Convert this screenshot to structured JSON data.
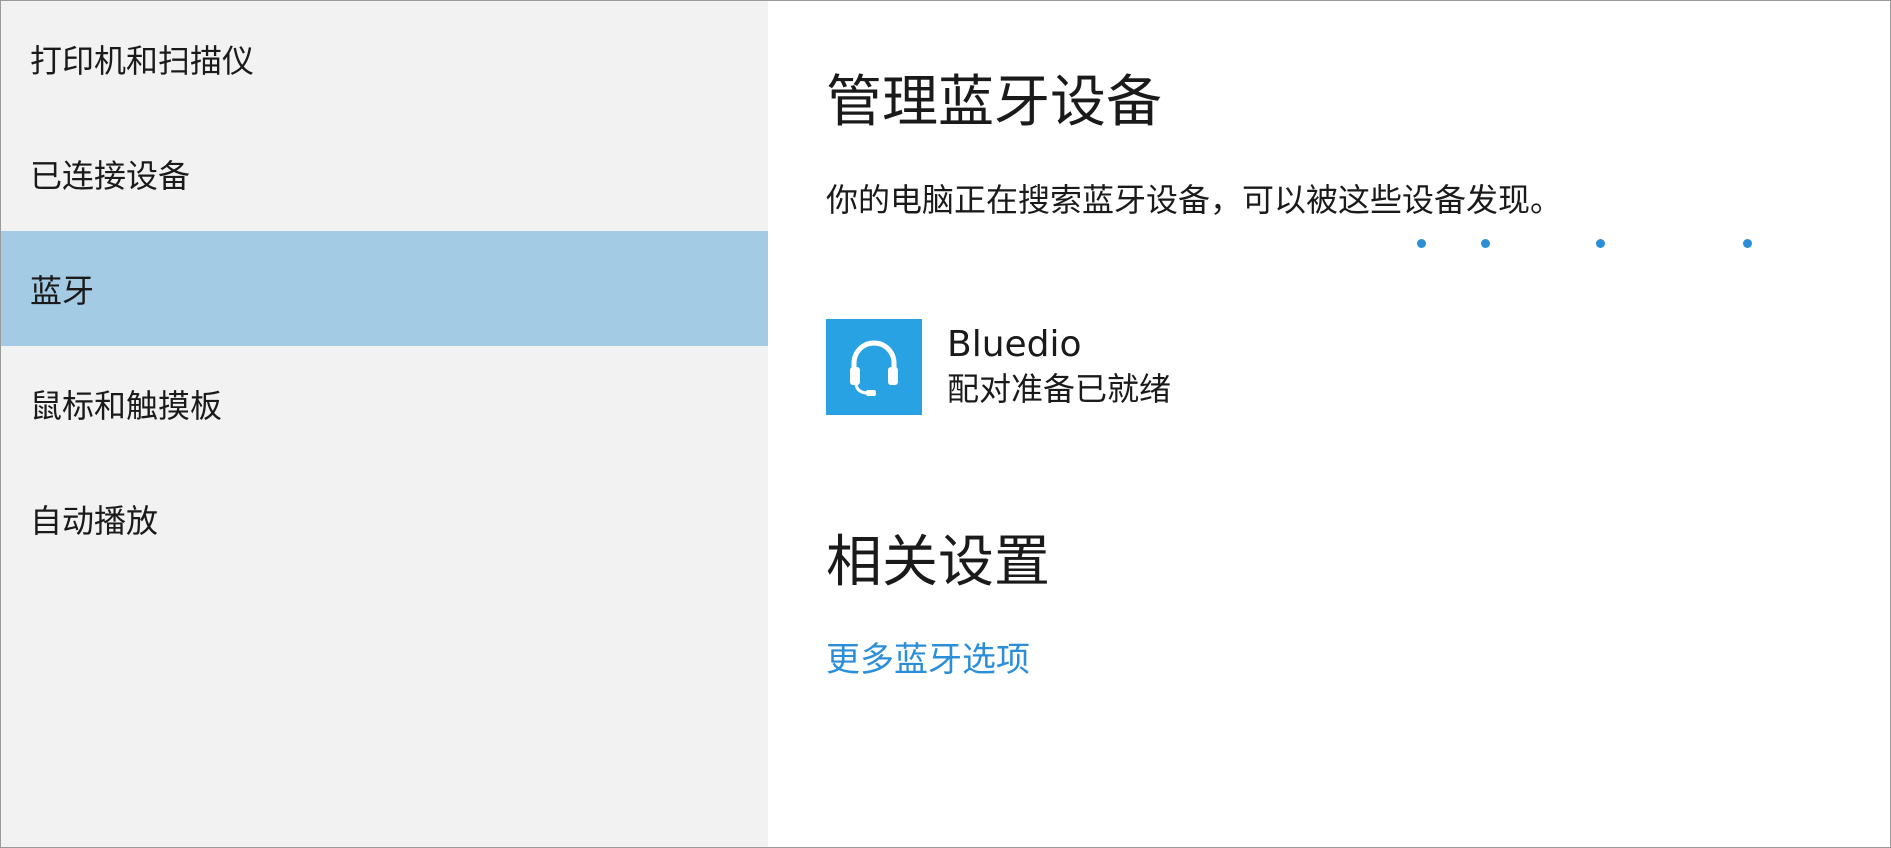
{
  "sidebar": {
    "items": [
      {
        "label": "打印机和扫描仪",
        "selected": false
      },
      {
        "label": "已连接设备",
        "selected": false
      },
      {
        "label": "蓝牙",
        "selected": true
      },
      {
        "label": "鼠标和触摸板",
        "selected": false
      },
      {
        "label": "自动播放",
        "selected": false
      }
    ]
  },
  "main": {
    "manage_title": "管理蓝牙设备",
    "description": "你的电脑正在搜索蓝牙设备，可以被这些设备发现。",
    "device": {
      "name": "Bluedio",
      "status": "配对准备已就绪",
      "icon": "headset-icon"
    },
    "related_title": "相关设置",
    "more_link": "更多蓝牙选项"
  },
  "colors": {
    "sidebar_bg": "#f2f2f2",
    "selected_bg": "#a3cbe3",
    "accent": "#2b8ed8",
    "device_tile": "#29a2e3"
  }
}
